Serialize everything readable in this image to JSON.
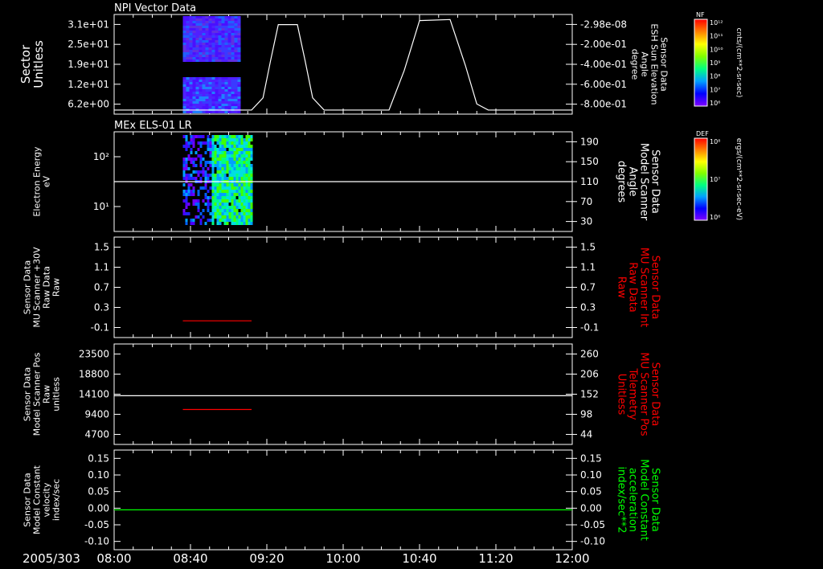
{
  "chart_data": [
    {
      "type": "spectrogram",
      "title": "NPI Vector Data",
      "ylabel_left": [
        "Sector",
        "Unitless"
      ],
      "yticks_left": [
        "3.1e+01",
        "2.5e+01",
        "1.9e+01",
        "1.2e+01",
        "6.2e+00"
      ],
      "ylabel_right": [
        "Sensor Data",
        "ESH Sun Elevation",
        "Angle",
        "degree"
      ],
      "yticks_right": [
        "-2.98e-08",
        "-2.00e-01",
        "-4.00e-01",
        "-6.00e-01",
        "-8.00e-01"
      ],
      "right_range": [
        -0.98,
        -3e-08
      ],
      "line_series": {
        "name": "ESH Sun Elevation Angle",
        "color": "#ffffff",
        "points": [
          [
            0,
            -0.94
          ],
          [
            72,
            -0.94
          ],
          [
            78,
            -0.82
          ],
          [
            82,
            -0.45
          ],
          [
            86,
            -0.1
          ],
          [
            96,
            -0.1
          ],
          [
            100,
            -0.45
          ],
          [
            104,
            -0.82
          ],
          [
            110,
            -0.94
          ],
          [
            144,
            -0.94
          ],
          [
            152,
            -0.55
          ],
          [
            160,
            -0.06
          ],
          [
            176,
            -0.05
          ],
          [
            184,
            -0.5
          ],
          [
            190,
            -0.88
          ],
          [
            196,
            -0.94
          ],
          [
            240,
            -0.94
          ]
        ]
      },
      "data_start_min": 36,
      "data_end_min": 66,
      "colorbar": {
        "label": "NF",
        "units": "cnts/(cm**2-sr-sec)",
        "ticks": [
          "10¹²",
          "10¹¹",
          "10¹⁰",
          "10⁹",
          "10⁸",
          "10⁷",
          "10⁶"
        ]
      }
    },
    {
      "type": "spectrogram",
      "title": "MEx ELS-01 LR",
      "ylabel_left": [
        "Electron Energy",
        "eV"
      ],
      "yticks_left": [
        "10²",
        "10¹"
      ],
      "ylabel_right": [
        "Sensor Data",
        "Model Scanner",
        "Angle",
        "degrees"
      ],
      "yticks_right": [
        "190",
        "150",
        "110",
        "70",
        "30"
      ],
      "right_range": [
        -10,
        190
      ],
      "line_series": {
        "name": "Model Scanner Angle",
        "color": "#ffffff",
        "points": [
          [
            0,
            90
          ],
          [
            240,
            90
          ]
        ]
      },
      "data_start_min": 36,
      "data_end_min": 72,
      "colorbar": {
        "label": "DEF",
        "units": "ergs/(cm**2-sr-sec-eV)",
        "ticks": [
          "10⁸",
          "10⁷",
          "10⁶"
        ]
      }
    },
    {
      "type": "line",
      "ylabel_left": [
        "Sensor Data",
        "MU Scanner +30V",
        "Raw Data",
        "Raw"
      ],
      "yticks_left": [
        "1.5",
        "1.1",
        "0.7",
        "0.3",
        "-0.1"
      ],
      "ylabel_right": [
        "Sensor Data",
        "MU Scanner Int",
        "Raw Data",
        "Raw"
      ],
      "ylabel_right_color": "#ff0000",
      "yticks_right": [
        "1.5",
        "1.1",
        "0.7",
        "0.3",
        "-0.1"
      ],
      "ylim": [
        -0.3,
        1.5
      ],
      "series": [
        {
          "name": "MU Scanner Int",
          "color": "#ff0000",
          "x": [
            36,
            72
          ],
          "y": [
            0,
            0
          ]
        }
      ]
    },
    {
      "type": "line",
      "ylabel_left": [
        "Sensor Data",
        "Model Scanner Pos",
        "Raw",
        "unitless"
      ],
      "yticks_left": [
        "23500",
        "18800",
        "14100",
        "9400",
        "4700"
      ],
      "ylabel_right": [
        "Sensor Data",
        "MU Scanner Pos",
        "Telemetry",
        "Unitless"
      ],
      "ylabel_right_color": "#ff0000",
      "yticks_right": [
        "260",
        "206",
        "152",
        "98",
        "44"
      ],
      "ylim": [
        0,
        23500
      ],
      "right_range": [
        -10,
        260
      ],
      "series": [
        {
          "name": "Model Scanner Pos",
          "color": "#ffffff",
          "axis": "left",
          "x": [
            0,
            240
          ],
          "y": [
            11400,
            11400
          ]
        },
        {
          "name": "MU Scanner Pos",
          "color": "#ff0000",
          "axis": "right",
          "x": [
            36,
            72
          ],
          "y": [
            84,
            84
          ]
        }
      ]
    },
    {
      "type": "line",
      "ylabel_left": [
        "Sensor Data",
        "Model Constant",
        "velocity",
        "index/sec"
      ],
      "yticks_left": [
        "0.15",
        "0.10",
        "0.05",
        "0.00",
        "-0.05",
        "-0.10"
      ],
      "ylabel_right": [
        "Sensor Data",
        "Model Constant",
        "acceleration",
        "index/sec**2"
      ],
      "ylabel_right_color": "#00ff00",
      "yticks_right": [
        "0.15",
        "0.10",
        "0.05",
        "0.00",
        "-0.05",
        "-0.10"
      ],
      "ylim": [
        -0.1,
        0.15
      ],
      "series": [
        {
          "name": "Model Constant acceleration",
          "color": "#00ff00",
          "x": [
            0,
            240
          ],
          "y": [
            0,
            0
          ]
        }
      ]
    }
  ],
  "x_axis": {
    "start_label": "2005/303",
    "tick_labels": [
      "08:00",
      "08:40",
      "09:20",
      "10:00",
      "10:40",
      "11:20",
      "12:00"
    ],
    "range_min": [
      0,
      240
    ]
  }
}
